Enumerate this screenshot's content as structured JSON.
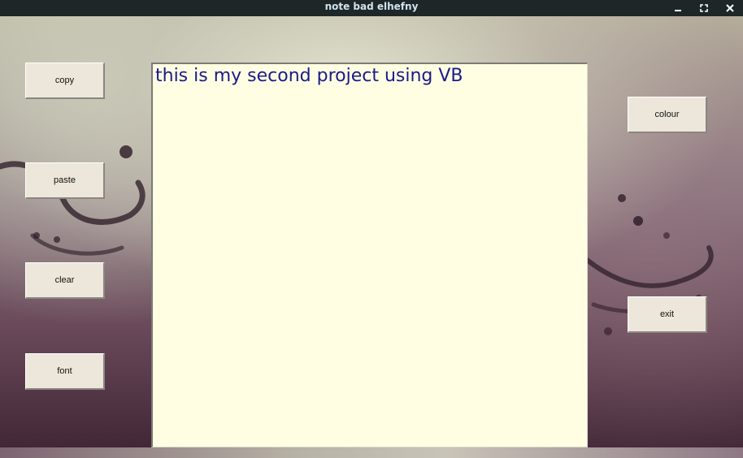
{
  "window": {
    "title": "note bad elhefny",
    "controls": {
      "minimize": "minimize",
      "maximize": "maximize",
      "close": "close"
    }
  },
  "buttons": {
    "copy": "copy",
    "paste": "paste",
    "clear": "clear",
    "font": "font",
    "colour": "colour",
    "exit": "exit"
  },
  "editor": {
    "value": "this is my second project using VB",
    "text_color": "#1a1a8a",
    "background_color": "#fffee2"
  },
  "icons": [
    "minimize-icon",
    "maximize-icon",
    "close-icon"
  ]
}
